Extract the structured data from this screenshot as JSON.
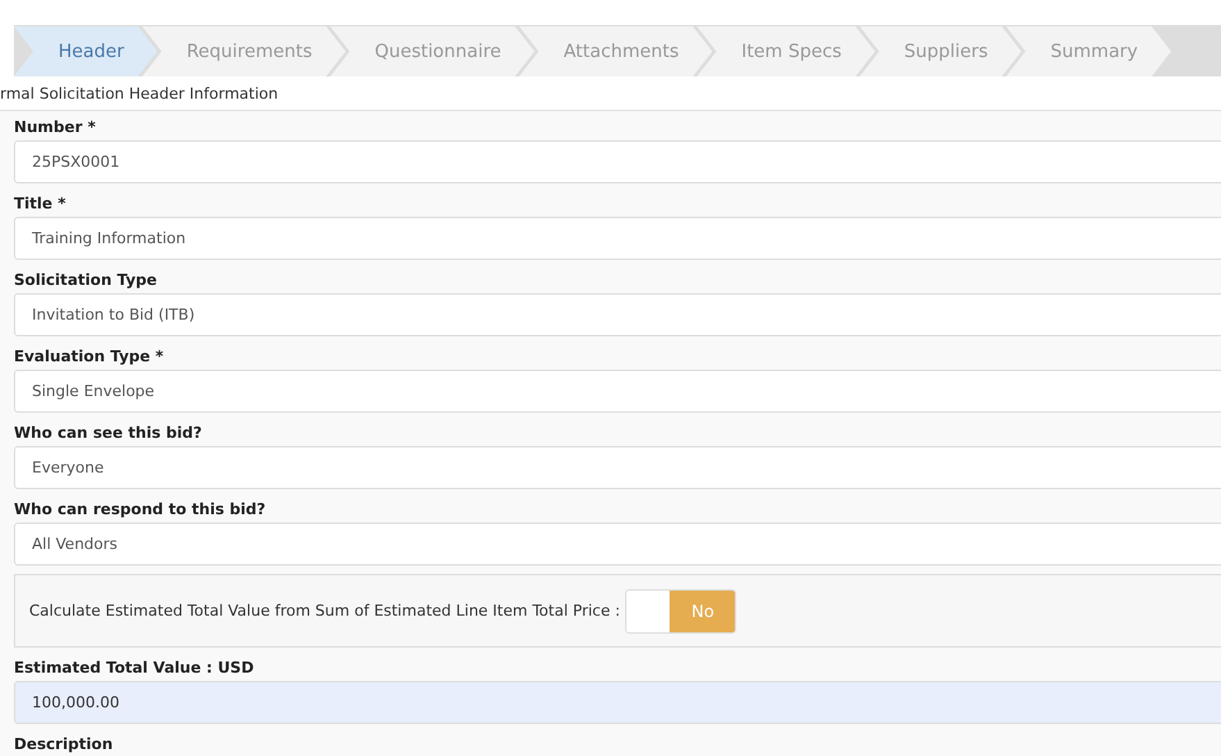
{
  "tabs": [
    {
      "label": "Header",
      "selected": true
    },
    {
      "label": "Requirements",
      "selected": false
    },
    {
      "label": "Questionnaire",
      "selected": false
    },
    {
      "label": "Attachments",
      "selected": false
    },
    {
      "label": "Item Specs",
      "selected": false
    },
    {
      "label": "Suppliers",
      "selected": false
    },
    {
      "label": "Summary",
      "selected": false
    }
  ],
  "section_title": "rmal Solicitation Header Information",
  "fields": [
    {
      "kind": "text",
      "label": "Number *",
      "value": "25PSX0001",
      "focused": false
    },
    {
      "kind": "text",
      "label": "Title *",
      "value": "Training Information",
      "focused": false
    },
    {
      "kind": "text",
      "label": "Solicitation Type",
      "value": "Invitation to Bid (ITB)",
      "focused": false
    },
    {
      "kind": "text",
      "label": "Evaluation Type *",
      "value": "Single Envelope",
      "focused": false
    },
    {
      "kind": "text",
      "label": "Who can see this bid?",
      "value": "Everyone",
      "focused": false
    },
    {
      "kind": "text",
      "label": "Who can respond to this bid?",
      "value": "All Vendors",
      "focused": false
    },
    {
      "kind": "toggle",
      "label": "Calculate Estimated Total Value from Sum of Estimated Line Item Total Price :",
      "on": false,
      "state_text": "No"
    },
    {
      "kind": "text",
      "label": "Estimated Total Value : USD",
      "value": "100,000.00",
      "focused": true
    },
    {
      "kind": "label",
      "label": "Description"
    }
  ]
}
